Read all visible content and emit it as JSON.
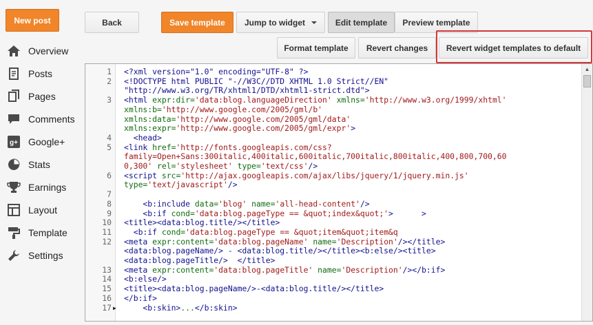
{
  "header": {
    "new_post": "New post",
    "back": "Back",
    "save_template": "Save template",
    "jump_to_widget": "Jump to widget",
    "edit_template": "Edit template",
    "preview_template": "Preview template",
    "format_template": "Format template",
    "revert_changes": "Revert changes",
    "revert_widget": "Revert widget templates to default"
  },
  "sidebar": {
    "items": [
      {
        "label": "Overview",
        "icon": "home-icon"
      },
      {
        "label": "Posts",
        "icon": "posts-icon"
      },
      {
        "label": "Pages",
        "icon": "pages-icon"
      },
      {
        "label": "Comments",
        "icon": "comments-icon"
      },
      {
        "label": "Google+",
        "icon": "google-plus-icon"
      },
      {
        "label": "Stats",
        "icon": "stats-icon"
      },
      {
        "label": "Earnings",
        "icon": "earnings-icon"
      },
      {
        "label": "Layout",
        "icon": "layout-icon"
      },
      {
        "label": "Template",
        "icon": "template-icon"
      },
      {
        "label": "Settings",
        "icon": "settings-icon"
      }
    ]
  },
  "editor": {
    "lines": [
      {
        "n": "1",
        "parts": [
          [
            "t",
            "<?xml version=\"1.0\" encoding=\"UTF-8\" ?>"
          ]
        ]
      },
      {
        "n": "2",
        "parts": [
          [
            "t",
            "<!DOCTYPE html PUBLIC \"-//W3C//DTD XHTML 1.0 Strict//EN\""
          ]
        ]
      },
      {
        "n": "",
        "parts": [
          [
            "t",
            "\"http://www.w3.org/TR/xhtml1/DTD/xhtml1-strict.dtd\">"
          ]
        ]
      },
      {
        "n": "3",
        "parts": [
          [
            "t",
            "<html "
          ],
          [
            "a",
            "expr:dir="
          ],
          [
            "s",
            "'data:blog.languageDirection'"
          ],
          [
            "a",
            " xmlns="
          ],
          [
            "s",
            "'http://www.w3.org/1999/xhtml'"
          ]
        ]
      },
      {
        "n": "",
        "parts": [
          [
            "a",
            "xmlns:b="
          ],
          [
            "s",
            "'http://www.google.com/2005/gml/b'"
          ]
        ]
      },
      {
        "n": "",
        "parts": [
          [
            "a",
            "xmlns:data="
          ],
          [
            "s",
            "'http://www.google.com/2005/gml/data'"
          ]
        ]
      },
      {
        "n": "",
        "parts": [
          [
            "a",
            "xmlns:expr="
          ],
          [
            "s",
            "'http://www.google.com/2005/gml/expr'"
          ],
          [
            "t",
            ">"
          ]
        ]
      },
      {
        "n": "4",
        "parts": [
          [
            "t",
            "  <head>"
          ]
        ]
      },
      {
        "n": "5",
        "parts": [
          [
            "t",
            "<link "
          ],
          [
            "a",
            "href="
          ],
          [
            "s",
            "'http://fonts.googleapis.com/css?"
          ]
        ]
      },
      {
        "n": "",
        "parts": [
          [
            "s",
            "family=Open+Sans:300italic,400italic,600italic,700italic,800italic,400,800,700,60"
          ]
        ]
      },
      {
        "n": "",
        "parts": [
          [
            "s",
            "0,300'"
          ],
          [
            "a",
            " rel="
          ],
          [
            "s",
            "'stylesheet'"
          ],
          [
            "a",
            " type="
          ],
          [
            "s",
            "'text/css'"
          ],
          [
            "t",
            "/>"
          ]
        ]
      },
      {
        "n": "6",
        "parts": [
          [
            "t",
            "<script "
          ],
          [
            "a",
            "src="
          ],
          [
            "s",
            "'http://ajax.googleapis.com/ajax/libs/jquery/1/jquery.min.js'"
          ]
        ]
      },
      {
        "n": "",
        "parts": [
          [
            "a",
            "type="
          ],
          [
            "s",
            "'text/javascript'"
          ],
          [
            "t",
            "/>"
          ]
        ]
      },
      {
        "n": "7",
        "parts": []
      },
      {
        "n": "8",
        "parts": [
          [
            "t",
            "    <b:include "
          ],
          [
            "a",
            "data="
          ],
          [
            "s",
            "'blog'"
          ],
          [
            "a",
            " name="
          ],
          [
            "s",
            "'all-head-content'"
          ],
          [
            "t",
            "/>"
          ]
        ]
      },
      {
        "n": "9",
        "parts": [
          [
            "t",
            "    <b:if "
          ],
          [
            "a",
            "cond="
          ],
          [
            "s",
            "'data:blog.pageType == &quot;index&quot;'"
          ],
          [
            "t",
            ">      >"
          ]
        ]
      },
      {
        "n": "10",
        "parts": [
          [
            "t",
            "<title><data:blog.title/></title>"
          ]
        ]
      },
      {
        "n": "11",
        "parts": [
          [
            "t",
            "  <b:if "
          ],
          [
            "a",
            "cond="
          ],
          [
            "s",
            "'data:blog.pageType == &quot;item&quot;item&q"
          ]
        ]
      },
      {
        "n": "12",
        "parts": [
          [
            "t",
            "<meta "
          ],
          [
            "a",
            "expr:content="
          ],
          [
            "s",
            "'data:blog.pageName'"
          ],
          [
            "a",
            " name="
          ],
          [
            "s",
            "'Description'"
          ],
          [
            "t",
            "/></title>"
          ]
        ]
      },
      {
        "n": "",
        "parts": [
          [
            "t",
            "<data:blog.pageName/> - <data:blog.title/></title><b:else/><title>"
          ]
        ]
      },
      {
        "n": "",
        "parts": [
          [
            "t",
            "<data:blog.pageTitle/>  </title>"
          ]
        ]
      },
      {
        "n": "13",
        "parts": [
          [
            "t",
            "<meta "
          ],
          [
            "a",
            "expr:content="
          ],
          [
            "s",
            "'data:blog.pageTitle'"
          ],
          [
            "a",
            " name="
          ],
          [
            "s",
            "'Description'"
          ],
          [
            "t",
            "/></b:if>"
          ]
        ]
      },
      {
        "n": "14",
        "parts": [
          [
            "t",
            "<b:else/>"
          ]
        ]
      },
      {
        "n": "15",
        "parts": [
          [
            "t",
            "<title><data:blog.pageName/>-<data:blog.title/></title>"
          ]
        ]
      },
      {
        "n": "16",
        "parts": [
          [
            "t",
            "</b:if>"
          ]
        ]
      },
      {
        "n": "17",
        "fold": "▶",
        "parts": [
          [
            "t",
            "    <b:skin>"
          ],
          [
            "a",
            "..."
          ],
          [
            "t",
            "</b:skin>"
          ]
        ]
      }
    ]
  }
}
